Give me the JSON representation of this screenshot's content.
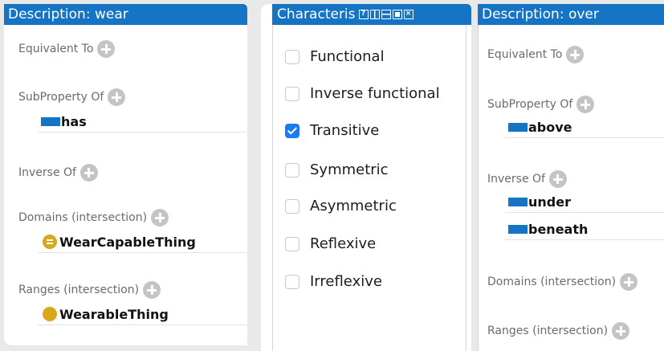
{
  "left_panel": {
    "title": "Description: wear",
    "sections": {
      "equivalent": "Equivalent To",
      "subproperty": "SubProperty Of",
      "inverse": "Inverse Of",
      "domains": "Domains (intersection)",
      "ranges": "Ranges (intersection)"
    },
    "subproperty_items": [
      "has"
    ],
    "domain_items": [
      "WearCapableThing"
    ],
    "range_items": [
      "WearableThing"
    ]
  },
  "middle_panel": {
    "title": "Characteris",
    "window_icons": [
      "help-icon",
      "split-vertical-icon",
      "split-horizontal-icon",
      "maximize-icon",
      "close-icon"
    ],
    "characteristics": [
      {
        "label": "Functional",
        "checked": false
      },
      {
        "label": "Inverse functional",
        "checked": false
      },
      {
        "label": "Transitive",
        "checked": true
      },
      {
        "label": "Symmetric",
        "checked": false
      },
      {
        "label": "Asymmetric",
        "checked": false
      },
      {
        "label": "Reflexive",
        "checked": false
      },
      {
        "label": "Irreflexive",
        "checked": false
      }
    ]
  },
  "right_panel": {
    "title": "Description: over",
    "sections": {
      "equivalent": "Equivalent To",
      "subproperty": "SubProperty Of",
      "inverse": "Inverse Of",
      "domains": "Domains (intersection)",
      "ranges": "Ranges (intersection)"
    },
    "subproperty_items": [
      "above"
    ],
    "inverse_items": [
      "under",
      "beneath"
    ]
  },
  "colors": {
    "title_bar": "#1574c4",
    "object_property": "#1574c4",
    "class_dot": "#d7a81a",
    "checkbox_checked": "#1a7cf0"
  }
}
